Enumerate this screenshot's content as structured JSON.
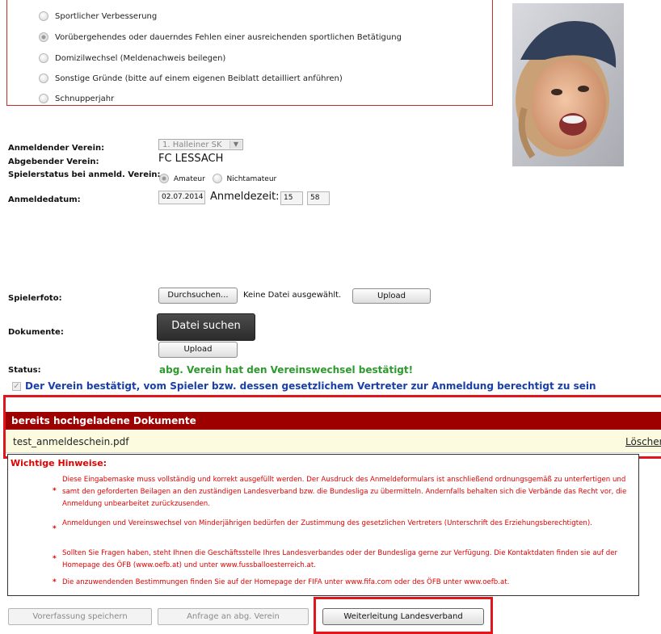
{
  "reasons": {
    "options": [
      {
        "label": "Sportlicher Verbesserung",
        "checked": false
      },
      {
        "label": "Vorübergehendes oder dauerndes Fehlen einer ausreichenden sportlichen Betätigung",
        "checked": true
      },
      {
        "label": "Domizilwechsel (Meldenachweis beilegen)",
        "checked": false
      },
      {
        "label": "Sonstige Gründe (bitte auf einem eigenen Beiblatt detailliert anführen)",
        "checked": false
      },
      {
        "label": "Schnupperjahr",
        "checked": false
      }
    ]
  },
  "form": {
    "anmeldender_verein_label": "Anmeldender Verein:",
    "anmeldender_verein_value": "1. Halleiner SK",
    "abgebender_verein_label": "Abgebender Verein:",
    "abgebender_verein_value": "FC LESSACH",
    "spielerstatus_label": "Spielerstatus bei anmeld. Verein:",
    "status_option_amateur": "Amateur",
    "status_option_nichtamateur": "Nichtamateur",
    "anmeldedatum_label": "Anmeldedatum:",
    "anmeldedatum_value": "02.07.2014",
    "anmeldezeit_label": "Anmeldezeit:",
    "anmeldezeit_hour": "15",
    "anmeldezeit_minute": "58"
  },
  "upload": {
    "spielerfoto_label": "Spielerfoto:",
    "browse_button": "Durchsuchen...",
    "no_file_text": "Keine Datei ausgewählt.",
    "upload_button": "Upload",
    "dokumente_label": "Dokumente:",
    "datei_suchen_button": "Datei suchen",
    "upload_button_2": "Upload"
  },
  "status": {
    "label": "Status:",
    "value": "abg. Verein hat den Vereinswechsel bestätigt!",
    "confirm_text": "Der Verein bestätigt, vom Spieler bzw. dessen gesetzlichem Vertreter zur Anmeldung berechtigt zu sein",
    "confirm_checked": true
  },
  "documents": {
    "header": "bereits hochgeladene Dokumente",
    "files": [
      {
        "name": "test_anmeldeschein.pdf",
        "action": "Löschen"
      }
    ]
  },
  "hints": {
    "title": "Wichtige Hinweise:",
    "items": [
      "Diese Eingabemaske muss vollständig und korrekt ausgefüllt werden. Der Ausdruck des Anmeldeformulars ist anschließend ordnungsgemäß zu unterfertigen und samt den geforderten Beilagen an den zuständigen Landesverband bzw. die Bundesliga zu übermitteln. Andernfalls behalten sich die Verbände das Recht vor, die Anmeldung unbearbeitet zurückzusenden.",
      "Anmeldungen und Vereinswechsel von Minderjährigen bedürfen der Zustimmung des gesetzlichen Vertreters (Unterschrift des Erziehungsberechtigten).",
      "Sollten Sie Fragen haben, steht Ihnen die Geschäftsstelle Ihres Landesverbandes oder der Bundesliga gerne zur Verfügung. Die Kontaktdaten finden sie auf der Homepage des ÖFB (www.oefb.at) und unter www.fussballoesterreich.at.",
      "Die anzuwendenden Bestimmungen finden Sie auf der Homepage der FIFA unter www.fifa.com oder des ÖFB unter www.oefb.at."
    ]
  },
  "actions": {
    "save_draft": "Vorerfassung speichern",
    "request_club": "Anfrage an abg. Verein",
    "forward": "Weiterleitung Landesverband"
  },
  "colors": {
    "highlight_red": "#e0161d",
    "docs_header_bg": "#9e0000",
    "status_green": "#2c9a2c",
    "confirm_blue": "#1a3fa8"
  }
}
